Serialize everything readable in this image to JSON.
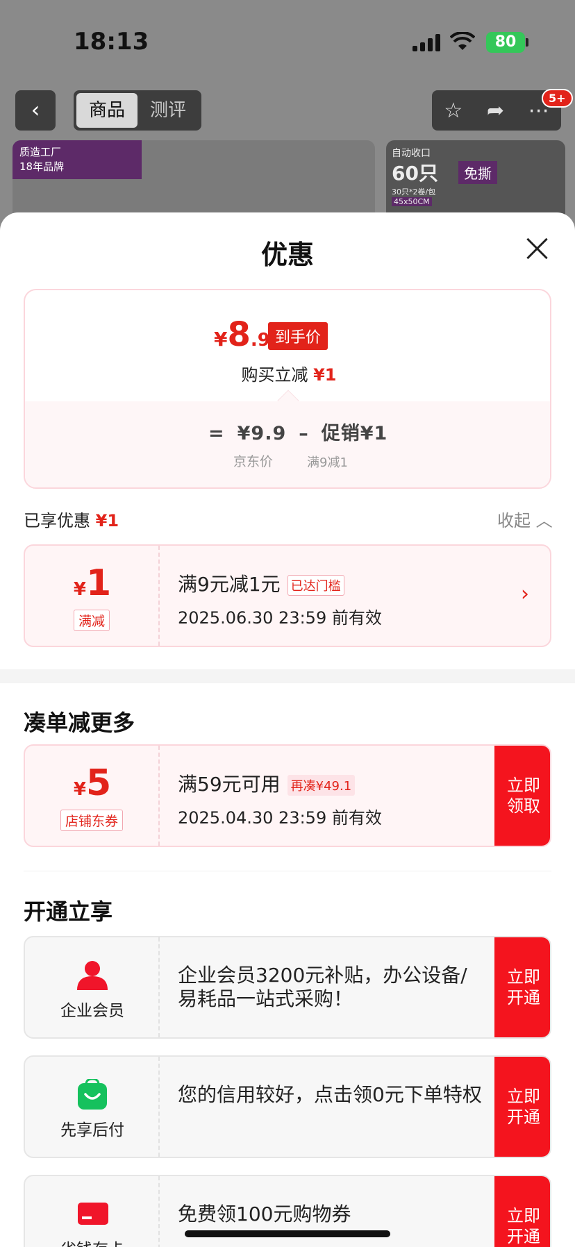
{
  "status_bar": {
    "time": "18:13",
    "battery": "80"
  },
  "top_nav": {
    "back_icon": "chevron-left-icon",
    "tabs": [
      {
        "label": "商品"
      },
      {
        "label": "测评"
      }
    ],
    "star_icon": "star-icon",
    "share_icon": "share-icon",
    "more_icon": "more-icon",
    "more_badge": "5+"
  },
  "background_banners": {
    "left_brand_line1": "质造工厂",
    "left_brand_line2": "18年品牌",
    "right_text1": "自动收口",
    "right_big": "60只",
    "right_tag": "免撕",
    "right_spec1": "30只*2卷/包",
    "right_spec2": "45x50CM"
  },
  "sheet": {
    "title": "优惠",
    "price": {
      "yen": "¥",
      "int": "8",
      "dec": ".9",
      "tag": "到手价",
      "cut_label": "购买立减",
      "cut_value": "¥1",
      "formula_eq": "=",
      "formula_price": "¥9.9",
      "formula_minus": "–",
      "formula_promo": "促销¥1",
      "jd_price_label": "京东价",
      "promo_desc": "满9减1"
    },
    "enjoyed": {
      "label": "已享优惠",
      "value": "¥1",
      "collapse": "收起"
    },
    "applied_coupon": {
      "yen": "¥",
      "amount": "1",
      "tag": "满减",
      "title": "满9元减1元",
      "badge": "已达门槛",
      "valid": "2025.06.30 23:59 前有效"
    },
    "more_section_title": "凑单减更多",
    "shop_coupon": {
      "yen": "¥",
      "amount": "5",
      "tag": "店铺东券",
      "title": "满59元可用",
      "badge": "再凑¥49.1",
      "valid": "2025.04.30 23:59 前有效",
      "action": "立即领取"
    },
    "open_section_title": "开通立享",
    "memberships": [
      {
        "icon": "person-icon",
        "label": "企业会员",
        "text": "企业会员3200元补贴，办公设备/易耗品一站式采购！",
        "action": "立即开通",
        "color": "#f0152a"
      },
      {
        "icon": "shopping-bag-icon",
        "label": "先享后付",
        "text": "您的信用较好，点击领0元下单特权",
        "action": "立即开通",
        "color": "#15c15d"
      },
      {
        "icon": "card-icon",
        "label": "省钱存卡",
        "text": "免费领100元购物券",
        "action": "立即开通",
        "color": "#f0152a"
      }
    ]
  }
}
